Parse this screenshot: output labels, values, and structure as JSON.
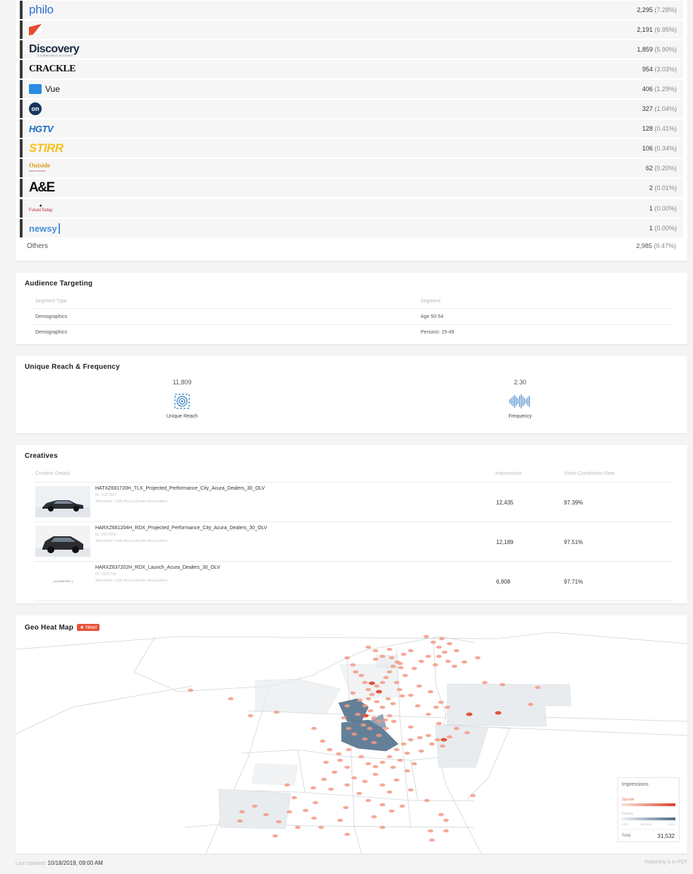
{
  "publishers": {
    "rows": [
      {
        "logo_text": "philo",
        "logo_kind": "philo",
        "value": "2,295",
        "pct": "(7.28%)"
      },
      {
        "logo_text": "",
        "logo_kind": "flag",
        "value": "2,191",
        "pct": "(6.95%)"
      },
      {
        "logo_text": "Discovery",
        "logo_sub": "COMMUNICATIONS",
        "logo_kind": "discovery",
        "value": "1,859",
        "pct": "(5.90%)"
      },
      {
        "logo_text": "CRACKLE",
        "logo_kind": "crackle",
        "value": "954",
        "pct": "(3.03%)"
      },
      {
        "logo_text": "Vue",
        "logo_kind": "vue",
        "value": "406",
        "pct": "(1.29%)"
      },
      {
        "logo_text": "on",
        "logo_kind": "on",
        "value": "327",
        "pct": "(1.04%)"
      },
      {
        "logo_text": "HGTV",
        "logo_kind": "hgtv",
        "value": "128",
        "pct": "(0.41%)"
      },
      {
        "logo_text": "STIRR",
        "logo_kind": "stirr",
        "value": "106",
        "pct": "(0.34%)"
      },
      {
        "logo_text": "Outside",
        "logo_sub": "TELEVISION",
        "logo_kind": "outside",
        "value": "62",
        "pct": "(0.20%)"
      },
      {
        "logo_text": "A&E",
        "logo_kind": "ae",
        "value": "2",
        "pct": "(0.01%)"
      },
      {
        "logo_text": "FutureToday",
        "logo_kind": "future",
        "value": "1",
        "pct": "(0.00%)"
      },
      {
        "logo_text": "newsy",
        "logo_kind": "newsy",
        "value": "1",
        "pct": "(0.00%)"
      }
    ],
    "others": {
      "label": "Others",
      "value": "2,985",
      "pct": "(9.47%)"
    }
  },
  "audience": {
    "title": "Audience Targeting",
    "col_type": "Segment Type",
    "col_segment": "Segment",
    "rows": [
      {
        "type": "Demographics",
        "segment": "Age 50-54"
      },
      {
        "type": "Demographics",
        "segment": "Persons: 25-49"
      }
    ]
  },
  "reach": {
    "title": "Unique Reach & Frequency",
    "unique_reach_value": "11,809",
    "unique_reach_label": "Unique Reach",
    "frequency_value": "2.30",
    "frequency_label": "Frequency"
  },
  "creatives": {
    "title": "Creatives",
    "col_details": "Creative Details",
    "col_impressions": "Impressions",
    "col_vcr": "Video Completion Rate",
    "rows": [
      {
        "name": "HATXZ681720H_TLX_Projected_Performance_City_Acura_Dealers_30_OLV",
        "id": "ID: 2027867",
        "advertiser": "Advertiser: Utah Acura Dealer Association",
        "impressions": "12,435",
        "vcr": "97.39%",
        "thumb": "sedan"
      },
      {
        "name": "HARXZ681204H_RDX_Projected_Performance_City_Acura_Dealers_30_OLV",
        "id": "ID: 2027866",
        "advertiser": "Advertiser: Utah Acura Dealer Association",
        "impressions": "12,189",
        "vcr": "97.51%",
        "thumb": "suv"
      },
      {
        "name": "HARXZ637202H_RDX_Launch_Acura_Dealers_30_OLV",
        "id": "ID: 2025739",
        "advertiser": "Advertiser: Utah Acura Dealer Association",
        "impressions": "6,908",
        "vcr": "97.71%",
        "thumb": "blank",
        "thumb_text": "[  ACURA RDX  ]"
      }
    ]
  },
  "geo": {
    "title": "Geo Heat Map",
    "badge": "★ New!",
    "legend": {
      "title": "Impressions",
      "zipcode": "Zipcode",
      "county": "County",
      "low": "LOW",
      "medium": "MEDIUM",
      "high": "HIGH",
      "total_label": "Total",
      "total_value": "31,532"
    },
    "colors": {
      "dot": "#f29a84",
      "dot_hot": "#e0553a",
      "county_dark": "#5c7a93",
      "county_light": "#e9ecef"
    }
  },
  "footer": {
    "last_updated_label": "Last Updated:",
    "last_updated_value": "10/18/2019, 09:00 AM",
    "reporting_note": "Reporting is in PDT"
  }
}
